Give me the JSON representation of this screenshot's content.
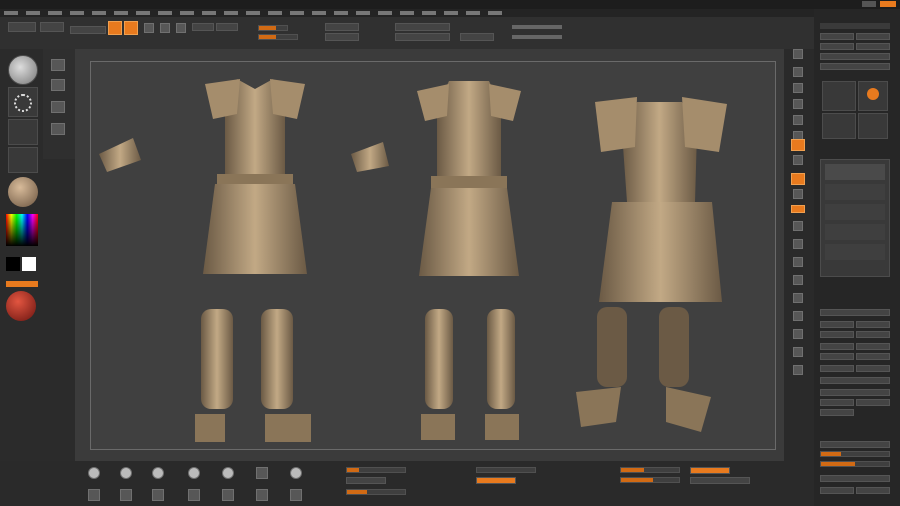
{
  "app": {
    "title": "",
    "accent": "#e87a1e"
  },
  "menu": {
    "items": []
  },
  "toolbar": {
    "lightbox_label": ""
  },
  "left_palette": {
    "tiles": [
      "brush",
      "stroke",
      "alpha",
      "texture",
      "material",
      "color"
    ]
  },
  "right_shelf": {
    "buttons": 20
  },
  "tray": {
    "title": ""
  },
  "bottom_shelf": {
    "tools": 14
  },
  "models": [
    "armor-front",
    "armor-back",
    "armor-3d",
    "leg-front",
    "leg-back",
    "bracer-left",
    "bracer-right"
  ]
}
